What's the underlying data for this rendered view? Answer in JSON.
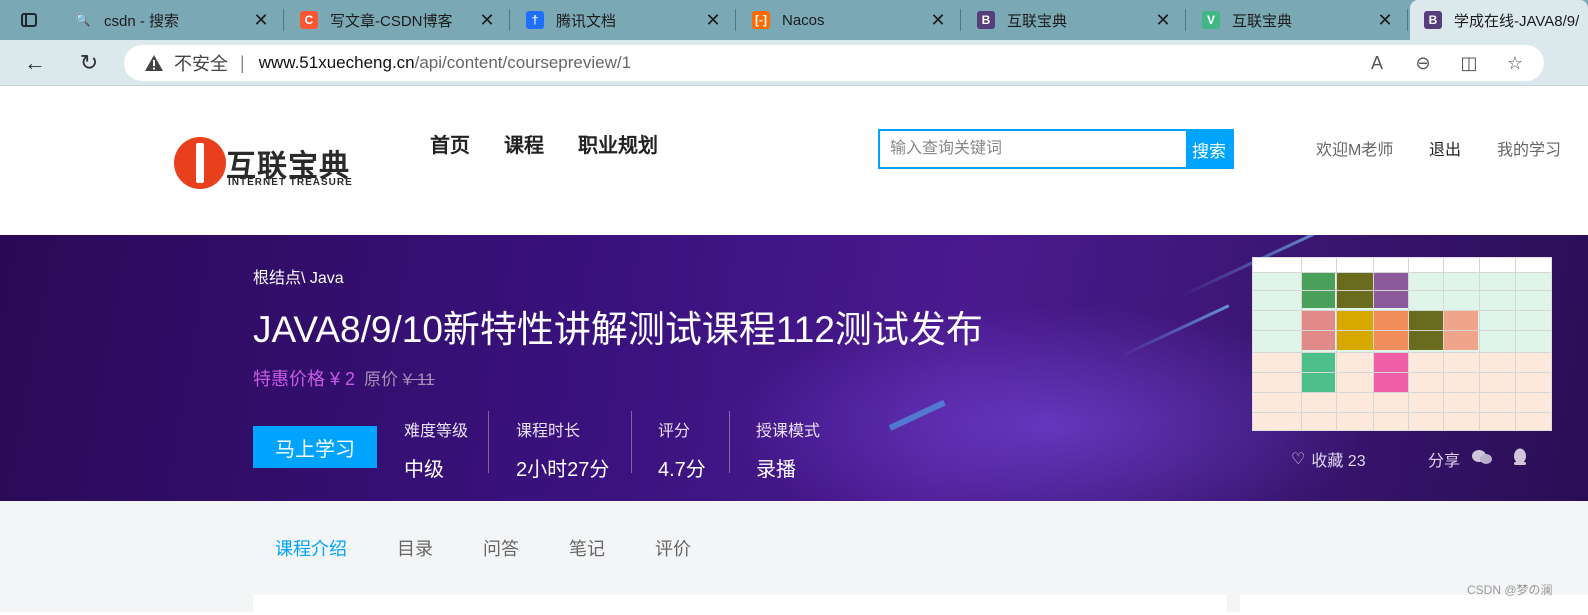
{
  "browser": {
    "tabs": [
      {
        "title": "csdn - 搜索",
        "icon": "search-icon",
        "icon_color": "#7aa8b5",
        "glyph": "🔍"
      },
      {
        "title": "写文章-CSDN博客",
        "icon": "csdn-icon",
        "icon_color": "#fc5531",
        "glyph": "C"
      },
      {
        "title": "腾讯文档",
        "icon": "tencent-docs-icon",
        "icon_color": "#1e6fff",
        "glyph": "†"
      },
      {
        "title": "Nacos",
        "icon": "alibaba-cloud-icon",
        "icon_color": "#ff6a00",
        "glyph": "[-]"
      },
      {
        "title": "互联宝典",
        "icon": "bootstrap-icon",
        "icon_color": "#563d7c",
        "glyph": "B"
      },
      {
        "title": "互联宝典",
        "icon": "vue-icon",
        "icon_color": "#41b883",
        "glyph": "V"
      },
      {
        "title": "学成在线-JAVA8/9/",
        "icon": "bootstrap-icon",
        "icon_color": "#563d7c",
        "glyph": "B"
      }
    ],
    "close_glyph": "✕",
    "address": {
      "insecure_label": "不安全",
      "separator": "|",
      "host": "www.51xuecheng.cn",
      "path": "/api/content/coursepreview/1"
    }
  },
  "header": {
    "logo_cn": "互联宝典",
    "logo_en": "INTERNET TREASURE",
    "nav": [
      "首页",
      "课程",
      "职业规划"
    ],
    "search_placeholder": "输入查询关键词",
    "search_button": "搜索",
    "welcome": "欢迎M老师",
    "logout": "退出",
    "my_learning": "我的学习"
  },
  "course": {
    "breadcrumb": "根结点\\ Java",
    "title": "JAVA8/9/10新特性讲解测试课程112测试发布",
    "price_label": "特惠价格 ¥ 2",
    "orig_label": "原价",
    "orig_price": "¥ 11",
    "learn_button": "马上学习",
    "stats": [
      {
        "label": "难度等级",
        "value": "中级"
      },
      {
        "label": "课程时长",
        "value": "2小时27分"
      },
      {
        "label": "评分",
        "value": "4.7分"
      },
      {
        "label": "授课模式",
        "value": "录播"
      }
    ],
    "favorite": "收藏 23",
    "share": "分享"
  },
  "tabs": [
    "课程介绍",
    "目录",
    "问答",
    "笔记",
    "评价"
  ],
  "watermark": "CSDN @梦の澜",
  "colors": {
    "accent": "#00a4ff",
    "price": "#c85be6",
    "banner": "#3b1280"
  }
}
